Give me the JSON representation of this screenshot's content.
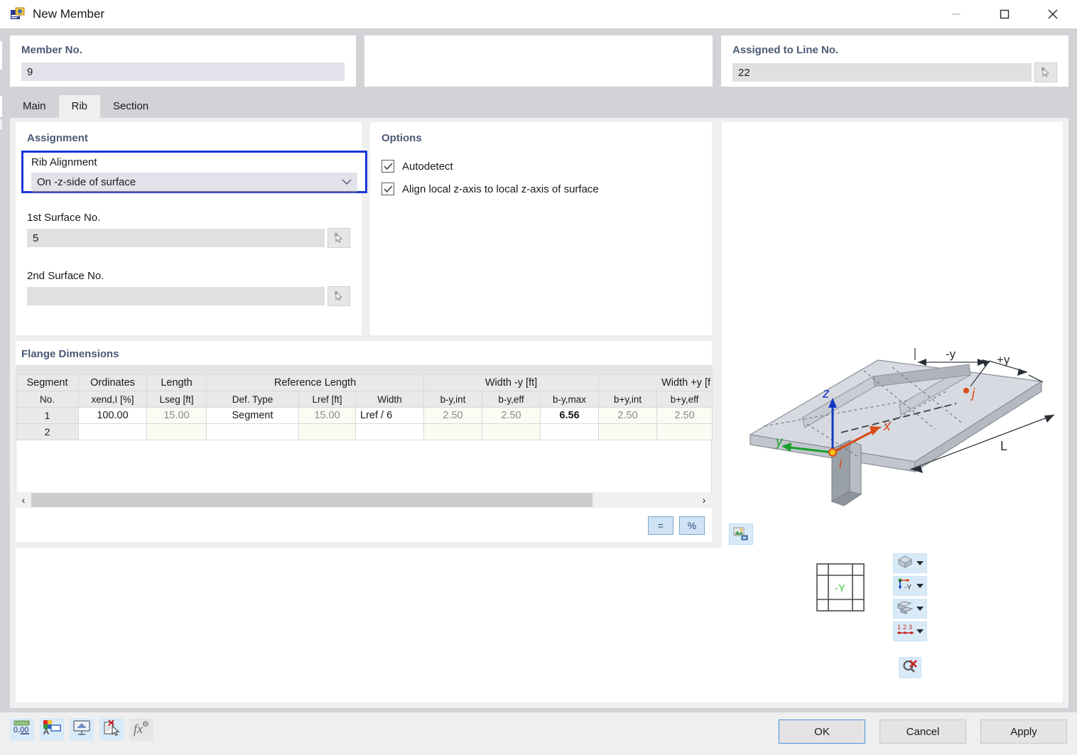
{
  "window": {
    "title": "New Member",
    "icon": "member-icon",
    "minimize": "minimize-icon",
    "maximize": "maximize-icon",
    "close": "close-icon"
  },
  "header": {
    "member_no_label": "Member No.",
    "member_no_value": "9",
    "assigned_line_label": "Assigned to Line No.",
    "assigned_line_value": "22"
  },
  "tabs": [
    {
      "label": "Main",
      "active": false
    },
    {
      "label": "Rib",
      "active": true
    },
    {
      "label": "Section",
      "active": false
    }
  ],
  "assignment": {
    "title": "Assignment",
    "rib_alignment_label": "Rib Alignment",
    "rib_alignment_value": "On -z-side of surface",
    "surface1_label": "1st Surface No.",
    "surface1_value": "5",
    "surface2_label": "2nd Surface No.",
    "surface2_value": ""
  },
  "options": {
    "title": "Options",
    "items": [
      {
        "label": "Autodetect",
        "checked": true
      },
      {
        "label": "Align local z-axis to local z-axis of surface",
        "checked": true
      }
    ]
  },
  "flange": {
    "title": "Flange Dimensions",
    "group_headers": [
      "Segment\nNo.",
      "Ordinates",
      "Length",
      "Reference Length",
      "Width -y [ft]",
      "Width +y [ft]"
    ],
    "columns": [
      {
        "group": "",
        "top": "Segment",
        "sub": "No."
      },
      {
        "group": "",
        "top": "Ordinates",
        "sub": "xend,I [%]"
      },
      {
        "group": "",
        "top": "Length",
        "sub": "Lseg [ft]"
      },
      {
        "group": "Reference Length",
        "top": "Reference Length",
        "sub": "Def. Type"
      },
      {
        "group": "Reference Length",
        "top": "",
        "sub": "Lref [ft]"
      },
      {
        "group": "Reference Length",
        "top": "",
        "sub": "Width"
      },
      {
        "group": "Width -y [ft]",
        "top": "Width -y [ft]",
        "sub": "b-y,int"
      },
      {
        "group": "Width -y [ft]",
        "top": "",
        "sub": "b-y,eff"
      },
      {
        "group": "Width -y [ft]",
        "top": "",
        "sub": "b-y,max"
      },
      {
        "group": "Width +y [ft]",
        "top": "Width +y [f",
        "sub": "b+y,int"
      },
      {
        "group": "Width +y [ft]",
        "top": "",
        "sub": "b+y,eff"
      }
    ],
    "rows": [
      {
        "no": "1",
        "ordinates": "100.00",
        "lseg": "15.00",
        "def_type": "Segment",
        "lref": "15.00",
        "width": "Lref / 6",
        "b_y_int": "2.50",
        "b_y_eff": "2.50",
        "b_y_max": "6.56",
        "bp_y_int": "2.50",
        "bp_y_eff": "2.50"
      },
      {
        "no": "2",
        "ordinates": "",
        "lseg": "",
        "def_type": "",
        "lref": "",
        "width": "",
        "b_y_int": "",
        "b_y_eff": "",
        "b_y_max": "",
        "bp_y_int": "",
        "bp_y_eff": ""
      }
    ],
    "scroll_left": "chevron-left-icon",
    "scroll_right": "chevron-right-icon",
    "equal_button": "=",
    "percent_button": "%"
  },
  "graphic": {
    "axis_z": "z",
    "axis_x": "x",
    "axis_y": "y",
    "node_i": "i",
    "node_j": "j",
    "dim_minus_y": "-y",
    "dim_plus_y": "+y",
    "dim_length": "L",
    "render_button": "render-settings-icon"
  },
  "viewpanel": {
    "grid_label": "-Y",
    "buttons": [
      {
        "name": "view-mode-dropdown",
        "icon": "cube-icon"
      },
      {
        "name": "axis-system-dropdown",
        "icon": "axes-y-icon"
      },
      {
        "name": "render-style-dropdown",
        "icon": "solid-blocks-icon"
      },
      {
        "name": "numbering-dropdown",
        "icon": "numbering-123-icon"
      }
    ],
    "clear_button": {
      "name": "clear-selection-button",
      "icon": "magnifier-delete-icon"
    }
  },
  "toolbar": [
    {
      "name": "units-button",
      "icon": "units-0.00-icon",
      "enabled": true
    },
    {
      "name": "display-properties-button",
      "icon": "color-label-icon",
      "enabled": true
    },
    {
      "name": "visibility-button",
      "icon": "monitor-icon",
      "enabled": true
    },
    {
      "name": "delete-entry-button",
      "icon": "document-delete-icon",
      "enabled": true
    },
    {
      "name": "formula-button",
      "icon": "fx-icon",
      "enabled": false
    }
  ],
  "dialog_buttons": [
    {
      "label": "OK",
      "primary": true
    },
    {
      "label": "Cancel",
      "primary": false
    },
    {
      "label": "Apply",
      "primary": false
    }
  ]
}
